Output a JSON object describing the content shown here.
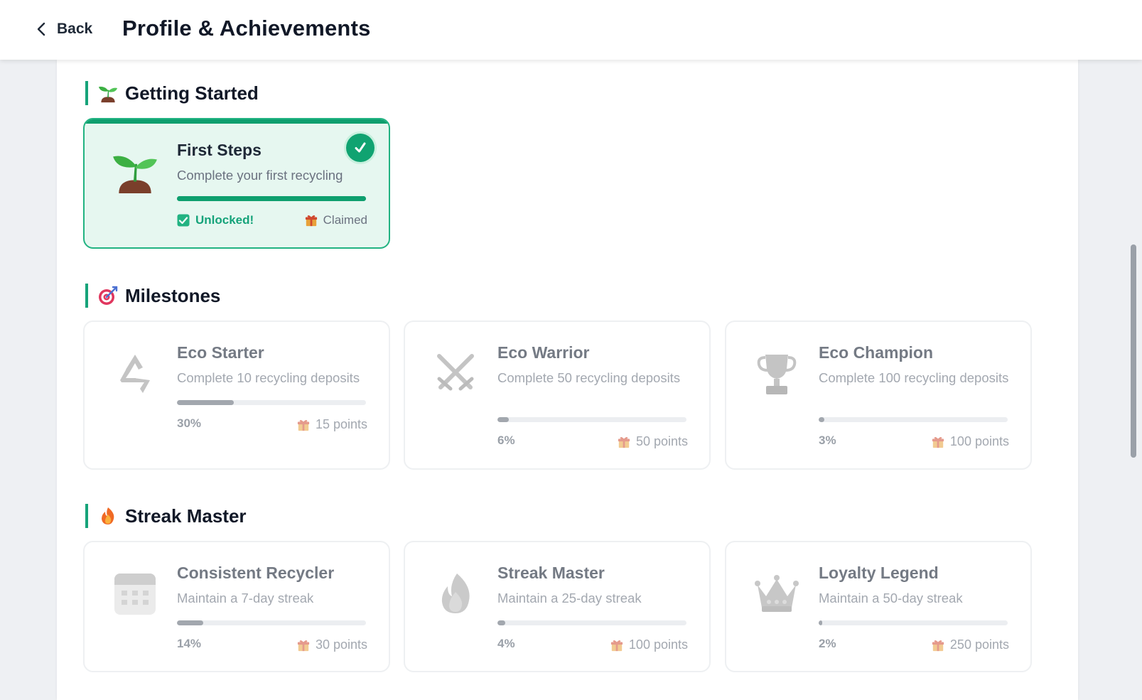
{
  "header": {
    "back_label": "Back",
    "title": "Profile & Achievements"
  },
  "sections": [
    {
      "title": "Getting Started",
      "icon": "seedling-icon",
      "cards": [
        {
          "title": "First Steps",
          "description": "Complete your first recycling",
          "icon": "seedling-icon",
          "status": "Unlocked!",
          "claim": "Claimed",
          "progress": 1.0
        }
      ]
    },
    {
      "title": "Milestones",
      "icon": "target-icon",
      "cards": [
        {
          "title": "Eco Starter",
          "description": "Complete 10 recycling deposits",
          "icon": "recycle-icon",
          "percent": "30%",
          "progress": 0.3,
          "reward": "15 points"
        },
        {
          "title": "Eco Warrior",
          "description": "Complete 50 recycling deposits",
          "icon": "crossed-swords-icon",
          "percent": "6%",
          "progress": 0.06,
          "reward": "50 points"
        },
        {
          "title": "Eco Champion",
          "description": "Complete 100 recycling deposits",
          "icon": "trophy-icon",
          "percent": "3%",
          "progress": 0.03,
          "reward": "100 points"
        }
      ]
    },
    {
      "title": "Streak Master",
      "icon": "fire-icon",
      "cards": [
        {
          "title": "Consistent Recycler",
          "description": "Maintain a 7-day streak",
          "icon": "calendar-icon",
          "percent": "14%",
          "progress": 0.14,
          "reward": "30 points"
        },
        {
          "title": "Streak Master",
          "description": "Maintain a 25-day streak",
          "icon": "flame-icon",
          "percent": "4%",
          "progress": 0.04,
          "reward": "100 points"
        },
        {
          "title": "Loyalty Legend",
          "description": "Maintain a 50-day streak",
          "icon": "crown-icon",
          "percent": "2%",
          "progress": 0.02,
          "reward": "250 points"
        }
      ]
    }
  ],
  "colors": {
    "accent": "#16a37a",
    "unlocked_bg": "#e6f7f0",
    "locked_text": "#a3a8b0"
  }
}
